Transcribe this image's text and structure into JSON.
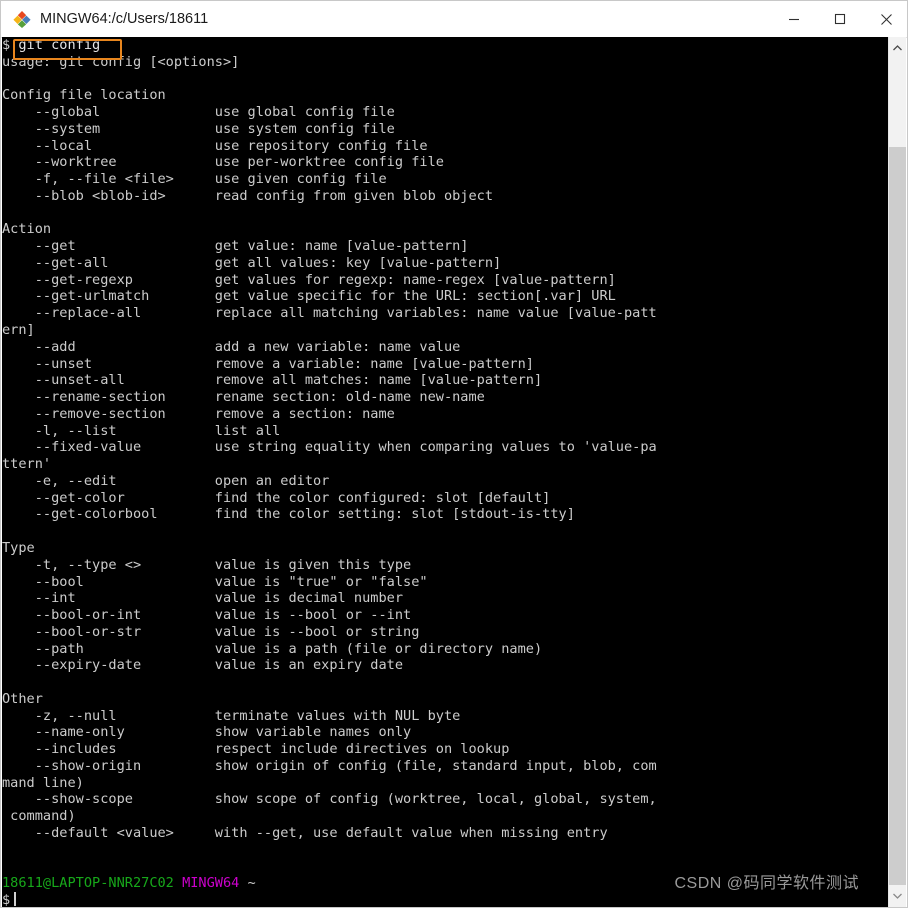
{
  "window": {
    "title": "MINGW64:/c/Users/18611",
    "icon": "git-bash-icon",
    "controls": {
      "minimize": "minimize-icon",
      "maximize": "maximize-icon",
      "close": "close-icon"
    }
  },
  "highlight": {
    "color": "#e8861e",
    "target_text": "git config"
  },
  "terminal": {
    "background": "#000000",
    "foreground": "#cccccc",
    "prompt_user_color": "#17a81a",
    "prompt_path_color": "#cc00cc",
    "lines": [
      "$ git config",
      "usage: git config [<options>]",
      "",
      "Config file location",
      "    --global              use global config file",
      "    --system              use system config file",
      "    --local               use repository config file",
      "    --worktree            use per-worktree config file",
      "    -f, --file <file>     use given config file",
      "    --blob <blob-id>      read config from given blob object",
      "",
      "Action",
      "    --get                 get value: name [value-pattern]",
      "    --get-all             get all values: key [value-pattern]",
      "    --get-regexp          get values for regexp: name-regex [value-pattern]",
      "    --get-urlmatch        get value specific for the URL: section[.var] URL",
      "    --replace-all         replace all matching variables: name value [value-patt",
      "ern]",
      "    --add                 add a new variable: name value",
      "    --unset               remove a variable: name [value-pattern]",
      "    --unset-all           remove all matches: name [value-pattern]",
      "    --rename-section      rename section: old-name new-name",
      "    --remove-section      remove a section: name",
      "    -l, --list            list all",
      "    --fixed-value         use string equality when comparing values to 'value-pa",
      "ttern'",
      "    -e, --edit            open an editor",
      "    --get-color           find the color configured: slot [default]",
      "    --get-colorbool       find the color setting: slot [stdout-is-tty]",
      "",
      "Type",
      "    -t, --type <>         value is given this type",
      "    --bool                value is \"true\" or \"false\"",
      "    --int                 value is decimal number",
      "    --bool-or-int         value is --bool or --int",
      "    --bool-or-str         value is --bool or string",
      "    --path                value is a path (file or directory name)",
      "    --expiry-date         value is an expiry date",
      "",
      "Other",
      "    -z, --null            terminate values with NUL byte",
      "    --name-only           show variable names only",
      "    --includes            respect include directives on lookup",
      "    --show-origin         show origin of config (file, standard input, blob, com",
      "mand line)",
      "    --show-scope          show scope of config (worktree, local, global, system,",
      " command)",
      "    --default <value>     with --get, use default value when missing entry",
      "",
      ""
    ],
    "prompt": {
      "user_host": "18611@LAPTOP-NNR27C02",
      "shell": "MINGW64",
      "cwd": "~",
      "symbol": "$"
    }
  },
  "watermark": {
    "text": "CSDN @码同学软件测试"
  },
  "scrollbar": {
    "up_arrow": "chevron-up-icon",
    "down_arrow": "chevron-down-icon"
  }
}
